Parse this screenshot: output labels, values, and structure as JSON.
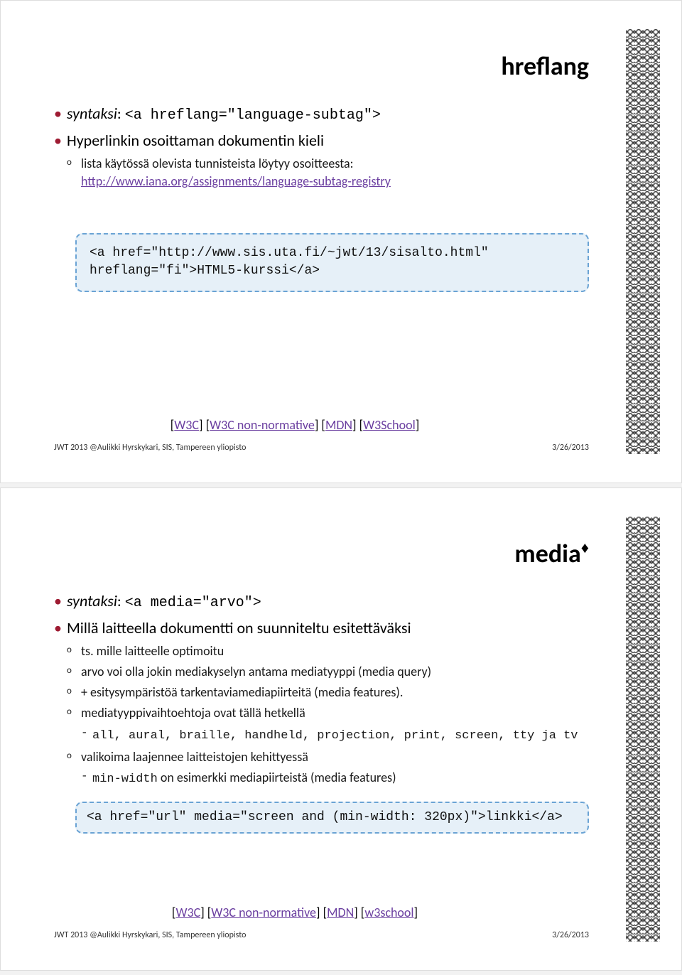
{
  "slide1": {
    "title": "hreflang",
    "bullets": [
      {
        "label_italic": "syntaksi",
        "label_rest": ": ",
        "code": "<a hreflang=\"language-subtag\">"
      },
      {
        "label": "Hyperlinkin osoittaman dokumentin kieli",
        "sub": [
          {
            "text": "lista käytössä olevista tunnisteista löytyy osoitteesta:",
            "link": "http://www.iana.org/assignments/language-subtag-registry"
          }
        ]
      }
    ],
    "code": "<a href=\"http://www.sis.uta.fi/~jwt/13/sisalto.html\" hreflang=\"fi\">HTML5-kurssi</a>",
    "refs": [
      "W3C",
      "W3C non-normative",
      "MDN",
      "W3School"
    ],
    "footer_left": "JWT 2013 @Aulikki Hyrskykari, SIS, Tampereen yliopisto",
    "footer_right": "3/26/2013"
  },
  "slide2": {
    "title": "media",
    "title_sup": "♦",
    "bullets": [
      {
        "label_italic": "syntaksi",
        "label_rest": ": ",
        "code": "<a media=\"arvo\">"
      },
      {
        "label": "Millä laitteella dokumentti on suunniteltu esitettäväksi",
        "sub": [
          {
            "text": "ts. mille laitteelle optimoitu"
          },
          {
            "text": "arvo voi olla jokin mediakyselyn antama mediatyyppi (media query)"
          },
          {
            "text": "+ esitysympäristöä tarkentaviamediapiirteitä (media features)."
          },
          {
            "text": "mediatyyppivaihtoehtoja ovat tällä hetkellä",
            "sub2": [
              {
                "code": "all, aural, braille, handheld, projection, print, screen, tty ja tv"
              }
            ]
          },
          {
            "text": "valikoima laajennee laitteistojen kehittyessä",
            "sub2": [
              {
                "code_prefix": "min-width",
                "text_after": " on esimerkki mediapiirteistä (media features)"
              }
            ]
          }
        ]
      }
    ],
    "code": "<a href=\"url\" media=\"screen and (min-width: 320px)\">linkki</a>",
    "refs": [
      "W3C",
      "W3C non-normative",
      "MDN",
      "w3school"
    ],
    "footer_left": "JWT 2013 @Aulikki Hyrskykari, SIS, Tampereen yliopisto",
    "footer_right": "3/26/2013"
  }
}
